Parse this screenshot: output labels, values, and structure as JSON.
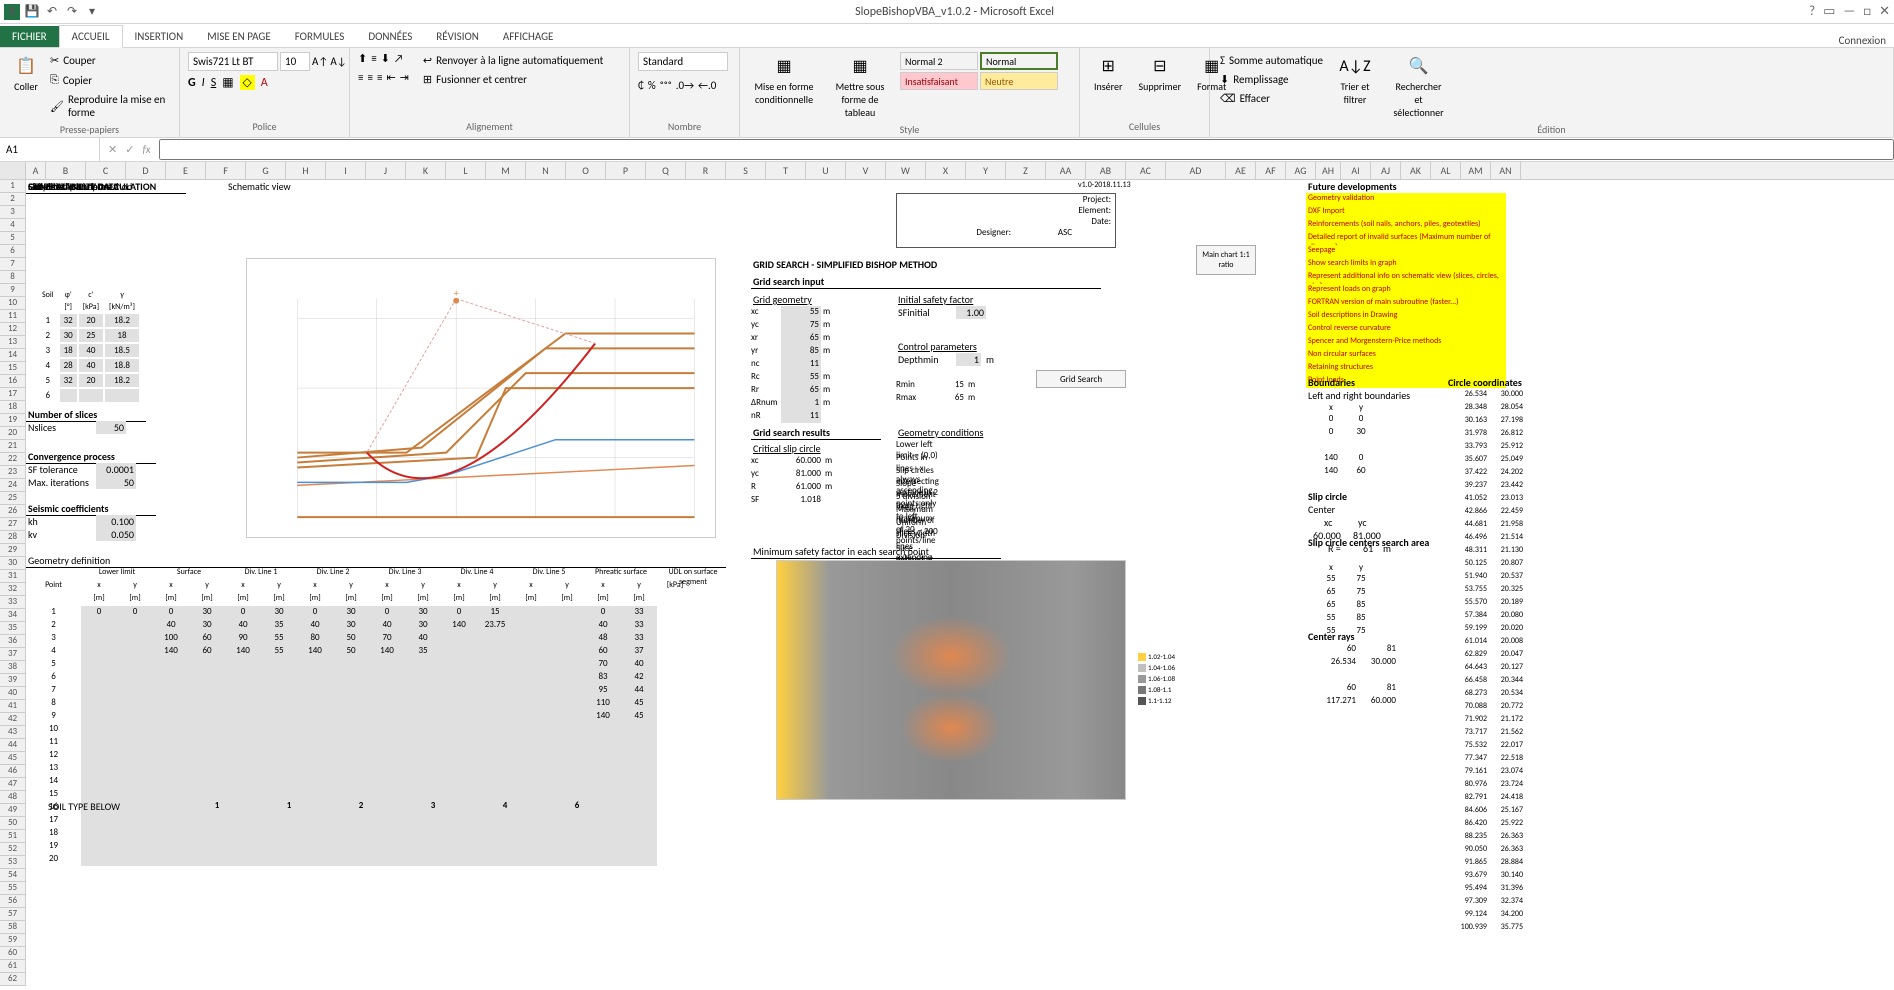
{
  "app": {
    "title": "SlopeBishopVBA_v1.0.2 - Microsoft Excel",
    "login": "Connexion"
  },
  "tabs": {
    "file": "FICHIER",
    "home": "ACCUEIL",
    "insert": "INSERTION",
    "layout": "MISE EN PAGE",
    "formulas": "FORMULES",
    "data": "DONNÉES",
    "review": "RÉVISION",
    "view": "AFFICHAGE"
  },
  "ribbon": {
    "clipboard": {
      "paste": "Coller",
      "cut": "Couper",
      "copy": "Copier",
      "format_painter": "Reproduire la mise en forme",
      "label": "Presse-papiers"
    },
    "font": {
      "name": "Swis721 Lt BT",
      "size": "10",
      "label": "Police"
    },
    "align": {
      "wrap": "Renvoyer à la ligne automatiquement",
      "merge": "Fusionner et centrer",
      "label": "Alignement"
    },
    "number": {
      "format": "Standard",
      "label": "Nombre"
    },
    "styles": {
      "cond": "Mise en forme conditionnelle",
      "table": "Mettre sous forme de tableau",
      "normal2": "Normal 2",
      "normal": "Normal",
      "bad": "Insatisfaisant",
      "neutral": "Neutre",
      "label": "Style"
    },
    "cells": {
      "insert": "Insérer",
      "delete": "Supprimer",
      "format": "Format",
      "label": "Cellules"
    },
    "editing": {
      "autosum": "Somme automatique",
      "fill": "Remplissage",
      "clear": "Effacer",
      "sort": "Trier et filtrer",
      "find": "Rechercher et sélectionner",
      "label": "Édition"
    }
  },
  "namebox": "A1",
  "sheet": {
    "title": "SLOPE STABILITY CALCULATION",
    "sub1": "Circular slip surfaces",
    "sub2": "Simplified Bishop method",
    "general_input": "GENERAL INPUT DATA",
    "soil_data_hdr": "Soil data",
    "schematic_hdr": "Schematic view",
    "soil_cols": [
      "Soil",
      "φ'",
      "c'",
      "γ"
    ],
    "soil_units": [
      "",
      "[°]",
      "[kPa]",
      "[kN/m³]"
    ],
    "soil_rows": [
      [
        "1",
        "32",
        "20",
        "18.2"
      ],
      [
        "2",
        "30",
        "25",
        "18"
      ],
      [
        "3",
        "18",
        "40",
        "18.5"
      ],
      [
        "4",
        "28",
        "40",
        "18.8"
      ],
      [
        "5",
        "32",
        "20",
        "18.2"
      ],
      [
        "6",
        "",
        "",
        ""
      ]
    ],
    "slices_hdr": "Number of slices",
    "slices_n": "Nslices",
    "slices_val": "50",
    "conv_hdr": "Convergence process",
    "sf_tol": "SF tolerance",
    "sf_tol_val": "0.0001",
    "max_iter": "Max. iterations",
    "max_iter_val": "50",
    "seismic_hdr": "Seismic coefficients",
    "kh": "kh",
    "kh_val": "0.100",
    "kv": "kv",
    "kv_val": "0.050",
    "geom_def": "Geometry definition",
    "geom_cols": [
      "Lower limit",
      "Surface",
      "Div. Line 1",
      "Div. Line 2",
      "Div. Line 3",
      "Div. Line 4",
      "Div. Line 5",
      "Phreatic surface",
      "UDL on surface segment"
    ],
    "geom_sub": [
      "Point",
      "x",
      "y",
      "x",
      "y",
      "x",
      "y",
      "x",
      "y",
      "x",
      "y",
      "x",
      "y",
      "x",
      "y",
      "x",
      "y",
      "[kPa]"
    ],
    "geom_units": "[m]",
    "geom_rows": [
      [
        "1",
        "0",
        "0",
        "0",
        "30",
        "0",
        "30",
        "0",
        "30",
        "0",
        "30",
        "0",
        "15",
        "",
        "",
        "0",
        "33"
      ],
      [
        "2",
        "",
        "",
        "40",
        "30",
        "40",
        "35",
        "40",
        "30",
        "40",
        "30",
        "140",
        "23.75",
        "",
        "",
        "40",
        "33"
      ],
      [
        "3",
        "",
        "",
        "100",
        "60",
        "90",
        "55",
        "80",
        "50",
        "70",
        "40",
        "",
        "",
        "",
        "",
        "48",
        "33"
      ],
      [
        "4",
        "",
        "",
        "140",
        "60",
        "140",
        "55",
        "140",
        "50",
        "140",
        "35",
        "",
        "",
        "",
        "",
        "60",
        "37"
      ],
      [
        "5",
        "",
        "",
        "",
        "",
        "",
        "",
        "",
        "",
        "",
        "",
        "",
        "",
        "",
        "",
        "70",
        "40"
      ],
      [
        "6",
        "",
        "",
        "",
        "",
        "",
        "",
        "",
        "",
        "",
        "",
        "",
        "",
        "",
        "",
        "83",
        "42"
      ],
      [
        "7",
        "",
        "",
        "",
        "",
        "",
        "",
        "",
        "",
        "",
        "",
        "",
        "",
        "",
        "",
        "95",
        "44"
      ],
      [
        "8",
        "",
        "",
        "",
        "",
        "",
        "",
        "",
        "",
        "",
        "",
        "",
        "",
        "",
        "",
        "110",
        "45"
      ],
      [
        "9",
        "",
        "",
        "",
        "",
        "",
        "",
        "",
        "",
        "",
        "",
        "",
        "",
        "",
        "",
        "140",
        "45"
      ]
    ],
    "soil_type_below": "SOIL TYPE BELOW",
    "soil_type_vals": [
      "1",
      "1",
      "2",
      "3",
      "4",
      "6"
    ],
    "project_lbl": "Project:",
    "element_lbl": "Element:",
    "date_lbl": "Date:",
    "designer_lbl": "Designer:",
    "designer_val": "ASC",
    "version": "v1.0-2018.11.13",
    "grid_title": "GRID SEARCH - SIMPLIFIED BISHOP METHOD",
    "grid_input": "Grid search input",
    "grid_geom": "Grid geometry",
    "init_sf": "Initial safety factor",
    "sf_init": "SFinitial",
    "sf_init_val": "1.00",
    "ctrl_params": "Control parameters",
    "depth": "Depthmin",
    "depth_val": "1",
    "depth_unit": "m",
    "grid_params": [
      [
        "xc",
        "55",
        "m"
      ],
      [
        "yc",
        "75",
        "m"
      ],
      [
        "xr",
        "65",
        "m"
      ],
      [
        "yr",
        "85",
        "m"
      ],
      [
        "nc",
        "11",
        ""
      ],
      [
        "Rc",
        "55",
        "m"
      ],
      [
        "Rr",
        "65",
        "m"
      ],
      [
        "ΔRnum",
        "1",
        "m"
      ],
      [
        "nR",
        "11",
        ""
      ]
    ],
    "r_params": [
      [
        "Rmin",
        "15",
        "m"
      ],
      [
        "Rmax",
        "65",
        "m"
      ]
    ],
    "grid_results": "Grid search results",
    "crit_circle": "Critical slip circle",
    "crit_vals": [
      [
        "xc",
        "60.000",
        "m"
      ],
      [
        "yc",
        "81.000",
        "m"
      ],
      [
        "R",
        "61.000",
        "m"
      ],
      [
        "SF",
        "1.018",
        ""
      ]
    ],
    "geom_cond": "Geometry conditions",
    "geom_notes": [
      "Lower left limit = (0,0)",
      "Points in lines - x always ascending",
      "Slip circles intersecting surface in 2 points only",
      "Slope movement from right to left",
      "5 division lines, maximum of 20 points/line",
      "Maximum number of slices = 200",
      "Uniform slice width",
      "Division lines extending always from xmin to xmax",
      "Slice defined at its center"
    ],
    "min_sf_hdr": "Minimum safety factor in each search point",
    "future_hdr": "Future developments",
    "future_items": [
      "Geometry validation",
      "DXF Import",
      "Reinforcements (soil nails, anchors, piles, geotextiles)",
      "Detailed report of invalid surfaces (Maximum number of slices, ...)",
      "Seepage",
      "Show search limits in graph",
      "Represent additional info on schematic view (slices, circles, etc.)",
      "Represent loads on graph",
      "FORTRAN version of main subroutine (faster...)",
      "Soil descriptions in Drawing",
      "Control reverse curvature",
      "Spencer and Morgenstern-Price methods",
      "Non circular surfaces",
      "Retaining structures",
      "Point loads"
    ],
    "boundaries_hdr": "Boundaries",
    "circle_coord_hdr": "Circle coordinates",
    "lr_bound": "Left and right boundaries",
    "bound_cols": [
      "x",
      "y"
    ],
    "bound_rows": [
      [
        "0",
        "0"
      ],
      [
        "0",
        "30"
      ],
      [
        "",
        "",
        ""
      ],
      [
        "140",
        "0"
      ],
      [
        "140",
        "60"
      ]
    ],
    "slip_circle_hdr": "Slip circle",
    "center_lbl": "Center",
    "center_cols": [
      "xc",
      "yc"
    ],
    "center_vals": [
      "60.000",
      "81.000"
    ],
    "r_eq": "R =",
    "r_val": "61",
    "r_unit": "m",
    "search_area_hdr": "Slip circle centers search area",
    "search_rows": [
      [
        "55",
        "75"
      ],
      [
        "65",
        "75"
      ],
      [
        "65",
        "85"
      ],
      [
        "55",
        "85"
      ],
      [
        "55",
        "75"
      ]
    ],
    "center_rays_hdr": "Center rays",
    "ray_rows": [
      [
        "60",
        "81"
      ],
      [
        "26.534",
        "30.000"
      ],
      [
        "",
        ""
      ],
      [
        "60",
        "81"
      ],
      [
        "117.271",
        "60.000"
      ]
    ],
    "circle_coords": [
      [
        "26.534",
        "30.000"
      ],
      [
        "28.348",
        "28.054"
      ],
      [
        "30.163",
        "27.198"
      ],
      [
        "31.978",
        "26.812"
      ],
      [
        "33.793",
        "25.912"
      ],
      [
        "35.607",
        "25.049"
      ],
      [
        "37.422",
        "24.202"
      ],
      [
        "39.237",
        "23.442"
      ],
      [
        "41.052",
        "23.013"
      ],
      [
        "42.866",
        "22.459"
      ],
      [
        "44.681",
        "21.958"
      ],
      [
        "46.496",
        "21.514"
      ],
      [
        "48.311",
        "21.130"
      ],
      [
        "50.125",
        "20.807"
      ],
      [
        "51.940",
        "20.537"
      ],
      [
        "53.755",
        "20.325"
      ],
      [
        "55.570",
        "20.189"
      ],
      [
        "57.384",
        "20.080"
      ],
      [
        "59.199",
        "20.020"
      ],
      [
        "61.014",
        "20.008"
      ],
      [
        "62.829",
        "20.047"
      ],
      [
        "64.643",
        "20.127"
      ],
      [
        "66.458",
        "20.344"
      ],
      [
        "68.273",
        "20.534"
      ],
      [
        "70.088",
        "20.772"
      ],
      [
        "71.902",
        "21.172"
      ],
      [
        "73.717",
        "21.562"
      ],
      [
        "75.532",
        "22.017"
      ],
      [
        "77.347",
        "22.518"
      ],
      [
        "79.161",
        "23.074"
      ],
      [
        "80.976",
        "23.724"
      ],
      [
        "82.791",
        "24.418"
      ],
      [
        "84.606",
        "25.167"
      ],
      [
        "86.420",
        "25.922"
      ],
      [
        "88.235",
        "26.363"
      ],
      [
        "90.050",
        "26.363"
      ],
      [
        "91.865",
        "28.884"
      ],
      [
        "93.679",
        "30.140"
      ],
      [
        "95.494",
        "31.396"
      ],
      [
        "97.309",
        "32.374"
      ],
      [
        "99.124",
        "34.200"
      ],
      [
        "100.939",
        "35.775"
      ]
    ],
    "main_chart_btn": "Main chart\n1:1 ratio",
    "grid_search_btn": "Grid Search",
    "legend": [
      "1.02-1.04",
      "1.04-1.06",
      "1.06-1.08",
      "1.08-1.1",
      "1.1-1.12"
    ]
  },
  "cols": [
    "A",
    "B",
    "C",
    "D",
    "E",
    "F",
    "G",
    "H",
    "I",
    "J",
    "K",
    "L",
    "M",
    "N",
    "O",
    "P",
    "Q",
    "R",
    "S",
    "T",
    "U",
    "V",
    "W",
    "X",
    "Y",
    "Z",
    "AA",
    "AB",
    "AC",
    "AD",
    "AE",
    "AF",
    "AG",
    "AH",
    "AI",
    "AJ",
    "AK",
    "AL",
    "AM",
    "AN"
  ]
}
